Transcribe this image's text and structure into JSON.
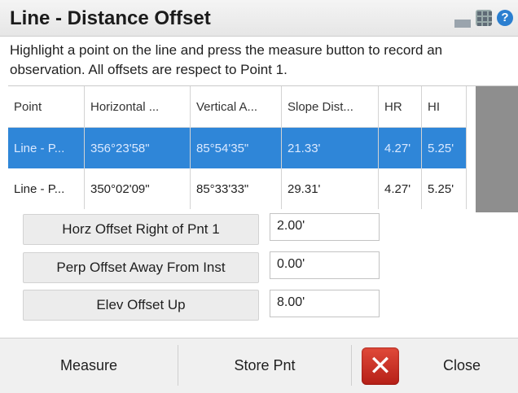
{
  "header": {
    "title": "Line - Distance Offset",
    "icons": [
      "signal-icon",
      "grid-icon",
      "help-icon"
    ]
  },
  "instructions": "Highlight a point on the line and press the measure button to record an observation. All offsets are respect to Point 1.",
  "grid": {
    "columns": [
      "Point",
      "Horizontal ...",
      "Vertical A...",
      "Slope Dist...",
      "HR",
      "HI"
    ],
    "rows": [
      {
        "point": "Line - P...",
        "horizontal": "356°23'58\"",
        "vertical": "85°54'35\"",
        "slope": "21.33'",
        "hr": "4.27'",
        "hi": "5.25'",
        "selected": true
      },
      {
        "point": "Line - P...",
        "horizontal": "350°02'09\"",
        "vertical": "85°33'33\"",
        "slope": "29.31'",
        "hr": "4.27'",
        "hi": "5.25'",
        "selected": false
      }
    ]
  },
  "fields": [
    {
      "label": "Horz Offset Right of Pnt 1",
      "value": "2.00'"
    },
    {
      "label": "Perp Offset Away From Inst",
      "value": "0.00'"
    },
    {
      "label": "Elev Offset Up",
      "value": "8.00'"
    }
  ],
  "footer": {
    "measure_label": "Measure",
    "store_label": "Store Pnt",
    "close_label": "Close"
  },
  "colors": {
    "selected_row": "#2f86d8",
    "close_icon": "#c62a20"
  }
}
